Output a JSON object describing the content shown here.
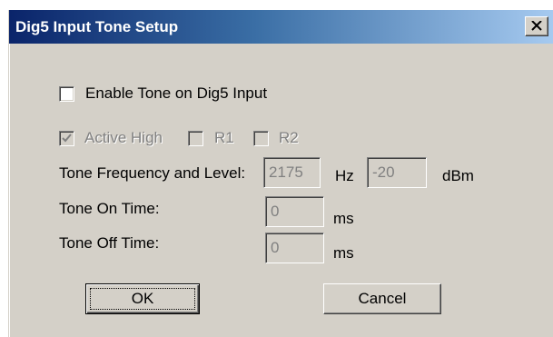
{
  "window": {
    "title": "Dig5 Input Tone Setup",
    "close_icon": "close-icon"
  },
  "enable_tone": {
    "label": "Enable Tone on Dig5 Input",
    "checked": false
  },
  "active_high": {
    "label": "Active High",
    "checked": true,
    "enabled": false
  },
  "r1": {
    "label": "R1",
    "checked": false,
    "enabled": false
  },
  "r2": {
    "label": "R2",
    "checked": false,
    "enabled": false
  },
  "tone_frequency": {
    "label": "Tone Frequency and Level:",
    "frequency_value": "2175",
    "frequency_unit": "Hz",
    "level_value": "-20",
    "level_unit": "dBm"
  },
  "tone_on_time": {
    "label": "Tone On Time:",
    "value": "0",
    "unit": "ms"
  },
  "tone_off_time": {
    "label": "Tone Off Time:",
    "value": "0",
    "unit": "ms"
  },
  "buttons": {
    "ok_label": "OK",
    "cancel_label": "Cancel"
  },
  "colors": {
    "titlebar_start": "#0a246a",
    "titlebar_end": "#a6caf0",
    "dialog_face": "#d4d0c8",
    "disabled_text": "#808080"
  }
}
